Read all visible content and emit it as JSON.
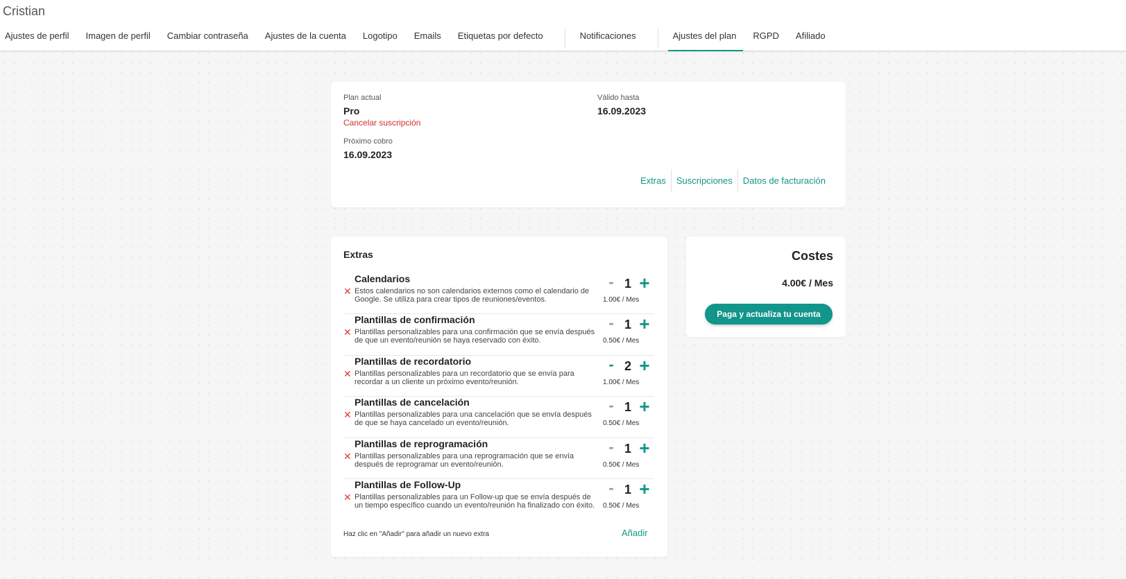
{
  "header": {
    "user_name": "Cristian",
    "tabs": [
      {
        "label": "Ajustes de perfil"
      },
      {
        "label": "Imagen de perfil"
      },
      {
        "label": "Cambiar contraseña"
      },
      {
        "label": "Ajustes de la cuenta"
      },
      {
        "label": "Logotipo"
      },
      {
        "label": "Emails"
      },
      {
        "label": "Etiquetas por defecto"
      },
      {
        "label": "Notificaciones"
      },
      {
        "label": "Ajustes del plan"
      },
      {
        "label": "RGPD"
      },
      {
        "label": "Afiliado"
      }
    ],
    "active_tab": "Ajustes del plan",
    "accent_color": "#12958a"
  },
  "plan": {
    "current_label": "Plan actual",
    "current_value": "Pro",
    "cancel_label": "Cancelar suscripción",
    "valid_label": "Válido hasta",
    "valid_value": "16.09.2023",
    "next_label": "Próximo cobro",
    "next_value": "16.09.2023",
    "links": [
      "Extras",
      "Suscripciones",
      "Datos de facturación"
    ]
  },
  "extras": {
    "title": "Extras",
    "items": [
      {
        "name": "Calendarios",
        "description": "Estos calendarios no son calendarios externos como el calendario de Google. Se utiliza para crear tipos de reuniones/eventos.",
        "quantity": "1",
        "price": "1.00€ / Mes"
      },
      {
        "name": "Plantillas de confirmación",
        "description": "Plantillas personalizables para una confirmación que se envía después de que un evento/reunión se haya reservado con éxito.",
        "quantity": "1",
        "price": "0.50€ / Mes"
      },
      {
        "name": "Plantillas de recordatorio",
        "description": "Plantillas personalizables para un recordatorio que se envía para recordar a un cliente un próximo evento/reunión.",
        "quantity": "2",
        "price": "1.00€ / Mes"
      },
      {
        "name": "Plantillas de cancelación",
        "description": "Plantillas personalizables para una cancelación que se envía después de que se haya cancelado un evento/reunión.",
        "quantity": "1",
        "price": "0.50€ / Mes"
      },
      {
        "name": "Plantillas de reprogramación",
        "description": "Plantillas personalizables para una reprogramación que se envía después de reprogramar un evento/reunión.",
        "quantity": "1",
        "price": "0.50€ / Mes"
      },
      {
        "name": "Plantillas de Follow-Up",
        "description": "Plantillas personalizables para un Follow-up que se envía después de un tiempo específico cuando un evento/reunión ha finalizado con éxito.",
        "quantity": "1",
        "price": "0.50€ / Mes"
      }
    ],
    "remove_symbol": "✕",
    "minus_symbol": "-",
    "plus_symbol": "+",
    "footer_hint": "Haz clic en \"Añadir\" para añadir un nuevo extra",
    "add_label": "Añadir"
  },
  "costs": {
    "title": "Costes",
    "total": "4.00€ / Mes",
    "pay_button": "Paga y actualiza tu cuenta"
  }
}
